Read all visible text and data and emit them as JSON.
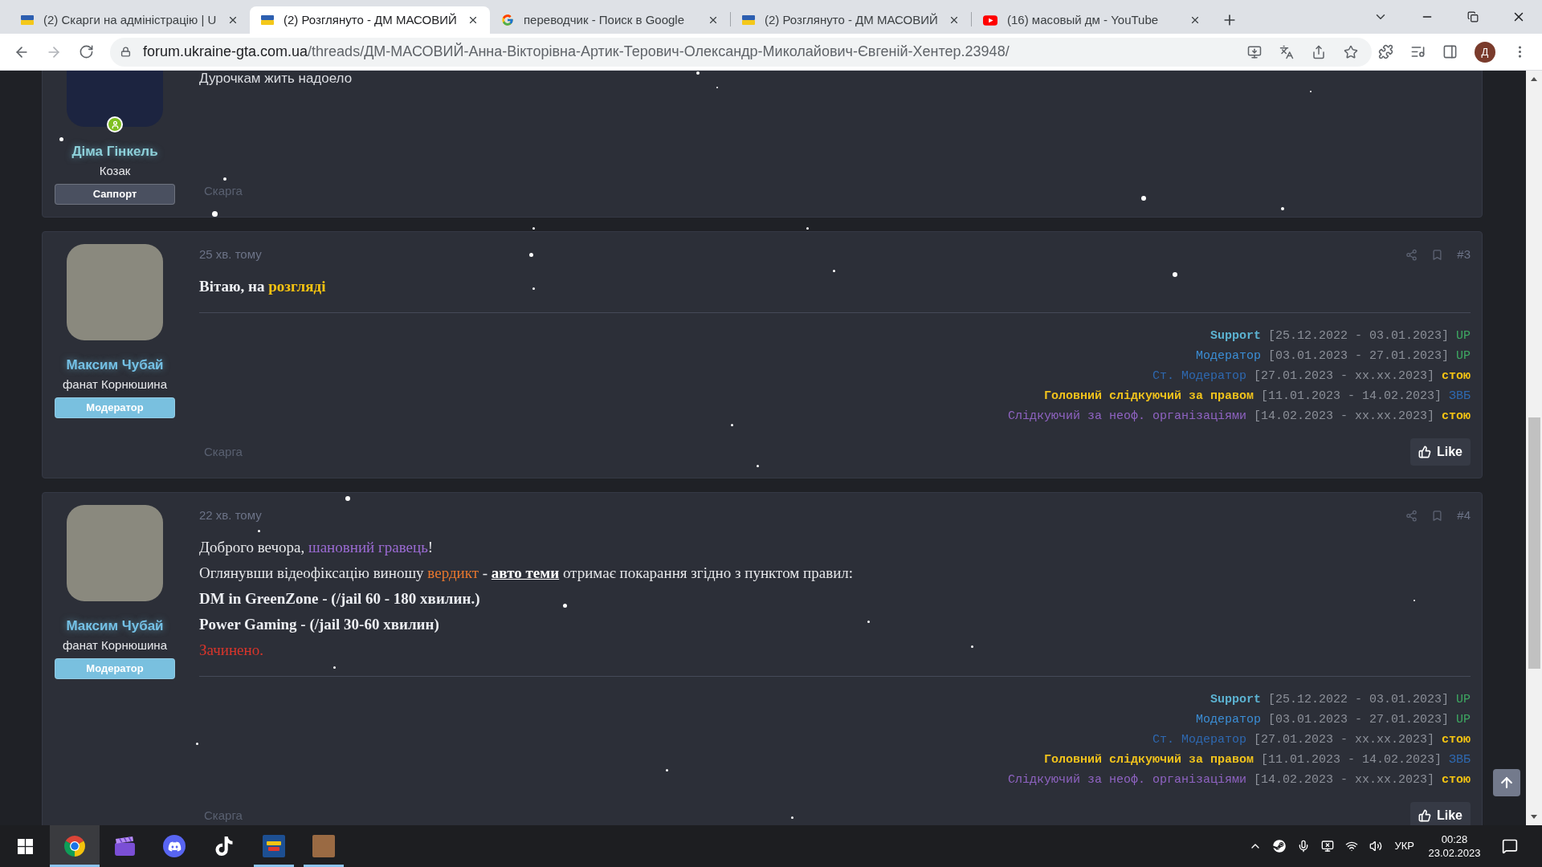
{
  "browser": {
    "tabs": [
      {
        "title": "(2) Скарги на адміністрацію | U",
        "kind": "forum",
        "selected": false
      },
      {
        "title": "(2) Розглянуто - ДМ МАСОВИЙ",
        "kind": "forum",
        "selected": true
      },
      {
        "title": "переводчик - Поиск в Google",
        "kind": "search",
        "selected": false
      },
      {
        "title": "(2) Розглянуто - ДМ МАСОВИЙ",
        "kind": "forum",
        "selected": false
      },
      {
        "title": "(16) масовый дм - YouTube",
        "kind": "video",
        "selected": false
      }
    ],
    "address": {
      "host": "forum.ukraine-gta.com.ua",
      "path": "/threads/ДМ-МАСОВИЙ-Анна-Вікторівна-Артик-Терович-Олександр-Миколайович-Євгеній-Хентер.23948/"
    },
    "profile": "Д"
  },
  "posts": [
    {
      "user": {
        "name": {
          "text": "Діма Гінкель",
          "color": "#8dd0d9"
        },
        "title": "Козак",
        "badge": {
          "text": "Саппорт",
          "color": "#4a5060"
        },
        "online": true,
        "avatar": {
          "color": "#1c2440"
        }
      },
      "content": [
        {
          "kind": "plain",
          "segments": [
            {
              "text": "Дурочкам жить надоело",
              "color": "#dcdee3",
              "bold": false,
              "kind": "text"
            }
          ]
        }
      ],
      "report": "Скарга"
    },
    {
      "date": "25 хв. тому",
      "number": "#3",
      "user": {
        "name": {
          "text": "Максим Чубай",
          "color": "#74c1e6"
        },
        "title": "фанат Корнюшина",
        "badge": {
          "text": "Модератор",
          "color": "#79c0df"
        },
        "online": false,
        "avatar": {
          "color": "#8a897e"
        }
      },
      "content": [
        {
          "kind": "styled",
          "segments": [
            {
              "text": "Вітаю, на ",
              "color": "#eceef2",
              "bold": true,
              "kind": "text"
            },
            {
              "text": "розгляді",
              "color": "#f5c211",
              "bold": true,
              "kind": "text"
            }
          ]
        }
      ],
      "signature": [
        [
          {
            "text": "Support",
            "color": "#5cb3d2",
            "bold": true
          },
          {
            "text": " [25.12.2022 - 03.01.2023] ",
            "color": "#8c9099",
            "bold": false
          },
          {
            "text": "UP",
            "color": "#3ea862",
            "bold": false
          }
        ],
        [
          {
            "text": "Модератор",
            "color": "#3b8ed6",
            "bold": false
          },
          {
            "text": " [03.01.2023 - 27.01.2023] ",
            "color": "#8c9099",
            "bold": false
          },
          {
            "text": "UP",
            "color": "#3ea862",
            "bold": false
          }
        ],
        [
          {
            "text": "Ст. Модератор",
            "color": "#2e68b0",
            "bold": false
          },
          {
            "text": " [27.01.2023 - xx.xx.2023] ",
            "color": "#8c9099",
            "bold": false
          },
          {
            "text": "стою",
            "color": "#f3c313",
            "bold": true
          }
        ],
        [
          {
            "text": "Головний слідкуючий за правом",
            "color": "#f0c21c",
            "bold": true
          },
          {
            "text": " [11.01.2023 - 14.02.2023] ",
            "color": "#8c9099",
            "bold": false
          },
          {
            "text": "ЗВБ",
            "color": "#2e68b0",
            "bold": false
          }
        ],
        [
          {
            "text": "Слідкуючий за неоф. організаціями",
            "color": "#8f63c2",
            "bold": false
          },
          {
            "text": " [14.02.2023 - xx.xx.2023] ",
            "color": "#8c9099",
            "bold": false
          },
          {
            "text": "стою",
            "color": "#f3c313",
            "bold": true
          }
        ]
      ],
      "report": "Скарга",
      "like": "Like"
    },
    {
      "date": "22 хв. тому",
      "number": "#4",
      "user": {
        "name": {
          "text": "Максим Чубай",
          "color": "#74c1e6"
        },
        "title": "фанат Корнюшина",
        "badge": {
          "text": "Модератор",
          "color": "#79c0df"
        },
        "online": false,
        "avatar": {
          "color": "#8a897e"
        }
      },
      "content": [
        {
          "kind": "styled",
          "segments": [
            {
              "text": "Доброго вечора, ",
              "color": "#e6e7ea",
              "bold": false,
              "kind": "text"
            },
            {
              "text": "шановний гравець",
              "color": "#9b6bd3",
              "bold": false,
              "kind": "text"
            },
            {
              "text": "!",
              "color": "#e6e7ea",
              "bold": false,
              "kind": "text"
            }
          ]
        },
        {
          "kind": "styled",
          "segments": [
            {
              "text": "Оглянувши відеофіксацію виношу ",
              "color": "#e6e7ea",
              "bold": false,
              "kind": "text"
            },
            {
              "text": "вердикт",
              "color": "#e8772e",
              "bold": false,
              "kind": "text"
            },
            {
              "text": " - ",
              "color": "#e6e7ea",
              "bold": false,
              "kind": "text"
            },
            {
              "text": "авто теми",
              "color": "#ffffff",
              "bold": true,
              "kind": "link"
            },
            {
              "text": " отримає покарання згідно з пунктом правил:",
              "color": "#e6e7ea",
              "bold": false,
              "kind": "text"
            }
          ]
        },
        {
          "kind": "styled",
          "segments": [
            {
              "text": "DM in GreenZone - (/jail 60 - 180 хвилин.)",
              "color": "#eceef2",
              "bold": true,
              "kind": "text"
            }
          ]
        },
        {
          "kind": "styled",
          "segments": [
            {
              "text": "Power Gaming - (/jail 30-60 хвилин)",
              "color": "#eceef2",
              "bold": true,
              "kind": "text"
            }
          ]
        },
        {
          "kind": "styled",
          "segments": [
            {
              "text": "Зачинено.",
              "color": "#d8352b",
              "bold": false,
              "kind": "text"
            }
          ]
        }
      ],
      "signature": [
        [
          {
            "text": "Support",
            "color": "#5cb3d2",
            "bold": true
          },
          {
            "text": " [25.12.2022 - 03.01.2023] ",
            "color": "#8c9099",
            "bold": false
          },
          {
            "text": "UP",
            "color": "#3ea862",
            "bold": false
          }
        ],
        [
          {
            "text": "Модератор",
            "color": "#3b8ed6",
            "bold": false
          },
          {
            "text": " [03.01.2023 - 27.01.2023] ",
            "color": "#8c9099",
            "bold": false
          },
          {
            "text": "UP",
            "color": "#3ea862",
            "bold": false
          }
        ],
        [
          {
            "text": "Ст. Модератор",
            "color": "#2e68b0",
            "bold": false
          },
          {
            "text": " [27.01.2023 - xx.xx.2023] ",
            "color": "#8c9099",
            "bold": false
          },
          {
            "text": "стою",
            "color": "#f3c313",
            "bold": true
          }
        ],
        [
          {
            "text": "Головний слідкуючий за правом",
            "color": "#f0c21c",
            "bold": true
          },
          {
            "text": " [11.01.2023 - 14.02.2023] ",
            "color": "#8c9099",
            "bold": false
          },
          {
            "text": "ЗВБ",
            "color": "#2e68b0",
            "bold": false
          }
        ],
        [
          {
            "text": "Слідкуючий за неоф. організаціями",
            "color": "#8f63c2",
            "bold": false
          },
          {
            "text": " [14.02.2023 - xx.xx.2023] ",
            "color": "#8c9099",
            "bold": false
          },
          {
            "text": "стою",
            "color": "#f3c313",
            "bold": true
          }
        ]
      ],
      "report": "Скарга",
      "like": "Like"
    }
  ],
  "taskbar": {
    "apps": [
      {
        "kind": "browser",
        "running": true,
        "selected": true
      },
      {
        "kind": "video-editor",
        "running": false,
        "selected": false
      },
      {
        "kind": "chat",
        "running": false,
        "selected": false
      },
      {
        "kind": "short-video",
        "running": false,
        "selected": false
      },
      {
        "kind": "game",
        "running": true,
        "selected": false
      },
      {
        "kind": "photo",
        "running": true,
        "selected": false
      }
    ],
    "language": "УКР",
    "time": "00:28",
    "date": "23.02.2023"
  }
}
